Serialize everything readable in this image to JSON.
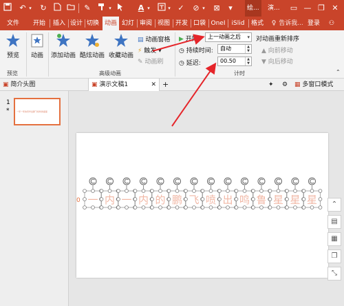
{
  "titlebar": {
    "doc_tab_1": "绘...",
    "doc_tab_2": "演...",
    "search_placeholder": "告诉我...",
    "login": "登录"
  },
  "tabs": [
    "文件",
    "开始",
    "插入",
    "设计",
    "切换",
    "动画",
    "幻灯",
    "审阅",
    "视图",
    "开发",
    "口袋",
    "OneI",
    "iSlid",
    "格式"
  ],
  "active_tab": "动画",
  "ribbon": {
    "preview": "预览",
    "animation": "动画",
    "add_animation": "添加动画",
    "fancy_animation": "酷炫动画",
    "favorite_animation": "收藏动画",
    "animation_pane": "动画窗格",
    "trigger": "触发",
    "animation_brush": "动画刷",
    "start_label": "开始:",
    "start_value": "上一动画之后",
    "duration_label": "持续时间:",
    "duration_value": "自动",
    "delay_label": "延迟:",
    "delay_value": "00.50",
    "reorder": "对动画重新排序",
    "move_earlier": "向前移动",
    "move_later": "向后移动",
    "group_preview": "预览",
    "group_advanced": "高级动画",
    "group_timing": "计时"
  },
  "docbar": {
    "tab1": "简介头图",
    "tab2": "演示文稿1",
    "multi_window": "多窗口模式"
  },
  "thumb": {
    "number": "1",
    "star": "*",
    "preview_text": "一年一年的风华出鹏飞喷鸣鲁星星"
  },
  "slide": {
    "text_chars": [
      "一",
      "内",
      "一",
      "内",
      "的",
      "鹏",
      "飞",
      "喷",
      "出",
      "鸣",
      "鲁",
      "星",
      "星",
      "星"
    ],
    "anim_index": "0"
  },
  "colors": {
    "brand": "#c9442a",
    "slide_text": "#f1b8a6",
    "arrow": "#e5252a"
  }
}
